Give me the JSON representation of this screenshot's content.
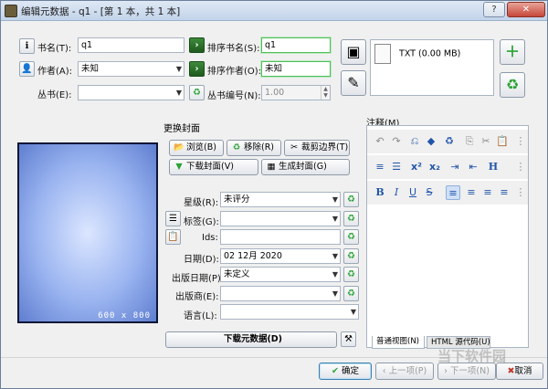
{
  "window": {
    "title": "编辑元数据 - q1 - [第 1 本，共 1 本]",
    "help": "?",
    "close": "✕"
  },
  "left_form": {
    "title_label": "书名(T):",
    "title_value": "q1",
    "title_sort_label": "排序书名(S):",
    "title_sort_value": "q1",
    "author_label": "作者(A):",
    "author_value": "未知",
    "author_sort_label": "排序作者(O):",
    "author_sort_value": "未知",
    "series_label": "丛书(E):",
    "series_value": "",
    "series_index_label": "丛书编号(N):",
    "series_index_value": "1.00"
  },
  "formats": {
    "item": "TXT (0.00 MB)"
  },
  "cover": {
    "group_title": "更换封面",
    "size_label": "600 x 800",
    "browse": "浏览(B)",
    "remove": "移除(R)",
    "trim": "裁剪边界(T)",
    "download": "下载封面(V)",
    "generate": "生成封面(G)"
  },
  "fields": {
    "rating_label": "星级(R):",
    "rating_value": "未评分",
    "tags_label": "标签(G):",
    "tags_value": "",
    "ids_label": "Ids:",
    "ids_value": "",
    "date_label": "日期(D):",
    "date_value": "02 12月 2020",
    "pubdate_label": "出版日期(P):",
    "pubdate_value": "未定义",
    "publisher_label": "出版商(E):",
    "publisher_value": "",
    "language_label": "语言(L):",
    "language_value": ""
  },
  "download_metadata": "下载元数据(D)",
  "notes": {
    "label": "注释(M)",
    "tab_normal": "普通视图(N)",
    "tab_html": "HTML 源代码(U)"
  },
  "footer": {
    "ok": "确定",
    "prev": "上一项(P)",
    "next": "下一项(N)",
    "cancel": "取消"
  },
  "watermark": "当下软件园",
  "colors": {
    "accent_green": "#2aa336",
    "cover_dark": "#0d1736"
  }
}
